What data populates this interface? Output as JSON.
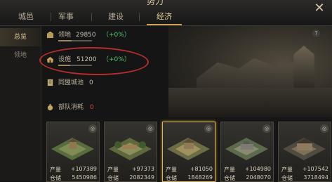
{
  "header": {
    "title": "势力",
    "tabs": [
      {
        "label": "城邑"
      },
      {
        "label": "军事"
      },
      {
        "label": "建设"
      },
      {
        "label": "经济"
      }
    ],
    "active_tab": "经济",
    "close_icon": "close-icon"
  },
  "sidebar": {
    "items": [
      {
        "label": "总览"
      },
      {
        "label": "领地"
      }
    ],
    "active_item": "总览"
  },
  "overview": {
    "rows": [
      {
        "label": "领地",
        "value": "29850",
        "change": "（+0%）",
        "icon": "territory-icon",
        "progress": 0.4
      },
      {
        "label": "设施",
        "value": "51200",
        "change": "（+0%）",
        "icon": "facility-icon",
        "progress": 0.35
      },
      {
        "label": "同盟城池",
        "value": "0",
        "icon": "alliance-city-icon"
      },
      {
        "label": "部队消耗",
        "value": "0",
        "icon": "troop-consumption-icon"
      }
    ],
    "help_icon": "?"
  },
  "cards": [
    {
      "production_label": "产量",
      "production": "+107389",
      "storage_label": "仓储",
      "storage": "5450986",
      "badge": "◎",
      "selected": false
    },
    {
      "production_label": "产量",
      "production": "+97373",
      "storage_label": "仓储",
      "storage": "2082349",
      "badge": "◎",
      "selected": false
    },
    {
      "production_label": "产量",
      "production": "+81050",
      "storage_label": "仓储",
      "storage": "1848269",
      "badge": "◎",
      "selected": true
    },
    {
      "production_label": "产量",
      "production": "+104980",
      "storage_label": "仓储",
      "storage": "2048070",
      "badge": "◎",
      "selected": false
    },
    {
      "production_label": "产量",
      "production": "+107542",
      "storage_label": "仓储",
      "storage": "3718494",
      "badge": "◎",
      "selected": false
    }
  ],
  "colors": {
    "accent_gold": "#c9a253",
    "positive_green": "#55c36b",
    "warning_red": "#d5483e",
    "circle_red": "#b52d2c"
  }
}
